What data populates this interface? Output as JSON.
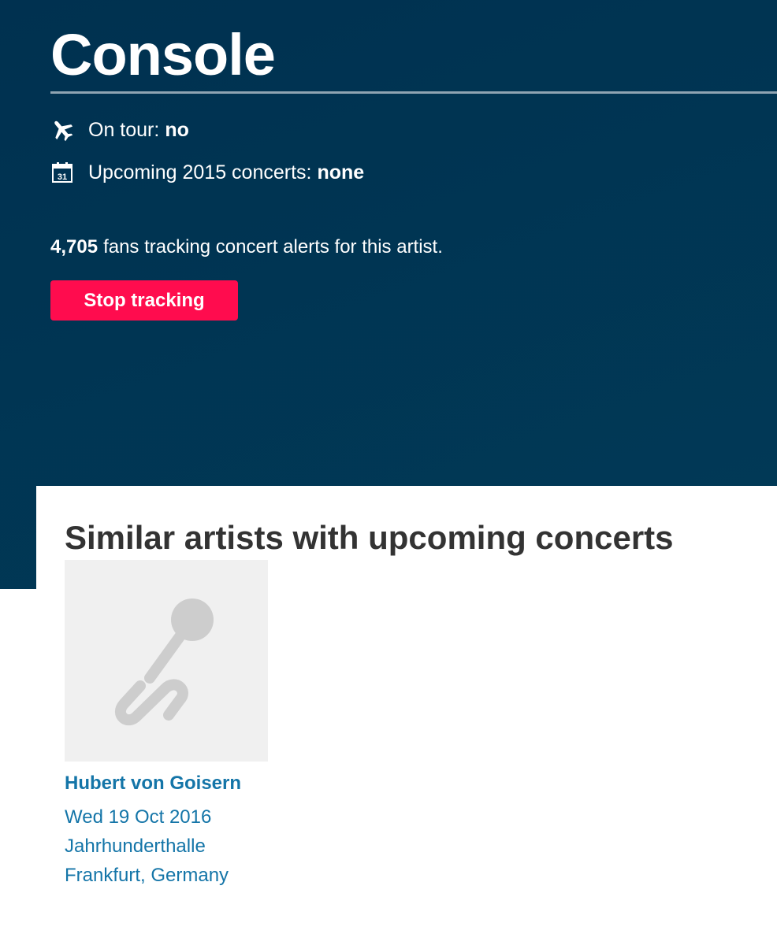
{
  "hero": {
    "title": "Console",
    "on_tour_label": "On tour:",
    "on_tour_value": "no",
    "on_tour_icon": "airplane-icon",
    "upcoming_label": "Upcoming 2015 concerts:",
    "upcoming_value": "none",
    "upcoming_icon": "calendar-icon",
    "calendar_day": "31",
    "fans_count": "4,705",
    "fans_text": "fans tracking concert alerts for this artist.",
    "stop_button_label": "Stop tracking"
  },
  "similar": {
    "title": "Similar artists with upcoming concerts",
    "artists": [
      {
        "name": "Hubert von Goisern",
        "date": "Wed 19 Oct 2016",
        "venue": "Jahrhunderthalle",
        "location": "Frankfurt, Germany",
        "image_icon": "microphone-icon"
      }
    ]
  },
  "colors": {
    "hero_background": "#003150",
    "stop_button": "#ff0c4e",
    "link": "#1475a8",
    "heading": "#333333"
  }
}
